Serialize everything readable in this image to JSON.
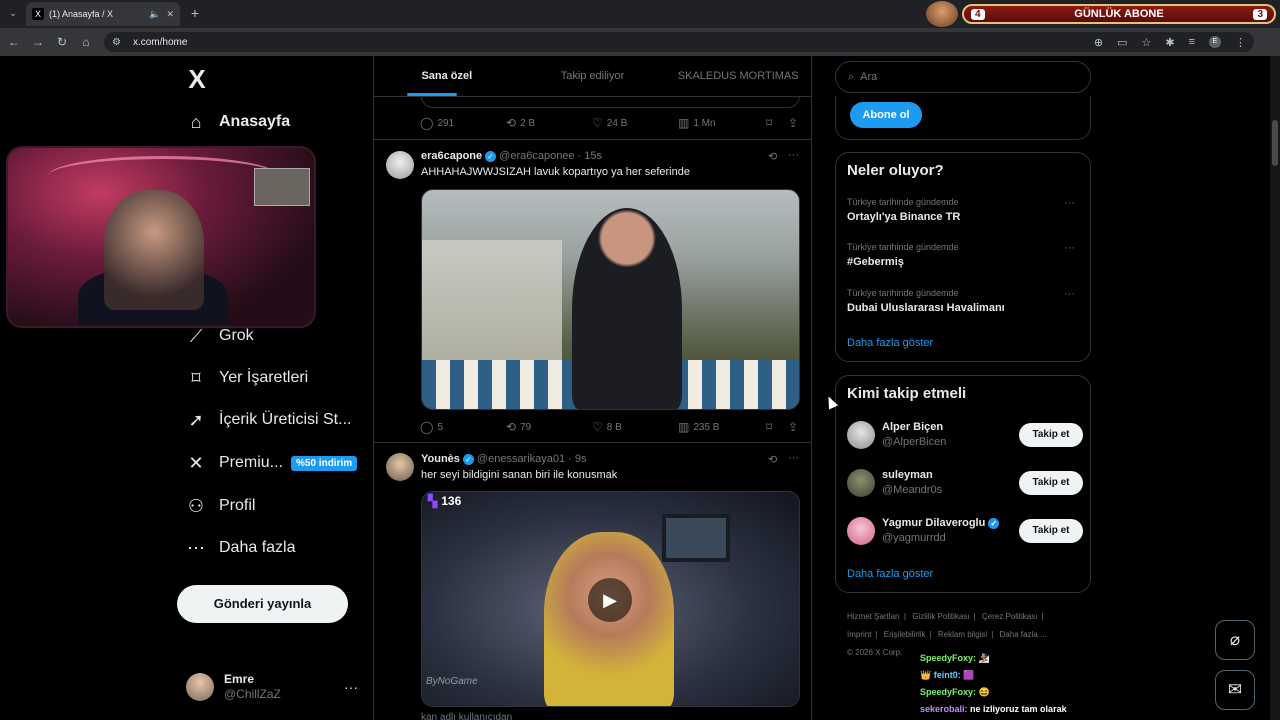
{
  "browser": {
    "tab_title": "(1) Anasayfa / X",
    "tab_favicon": "X",
    "url": "x.com/home",
    "profile_initial": "E"
  },
  "overlay": {
    "abone_left": "4",
    "abone_label": "GÜNLÜK ABONE",
    "abone_right": "3"
  },
  "nav": {
    "logo": "X",
    "items": [
      {
        "label": "Anasayfa",
        "icon": "home-icon"
      },
      {
        "label": "Grok",
        "icon": "grok-icon"
      },
      {
        "label": "Yer İşaretleri",
        "icon": "bookmark-icon"
      },
      {
        "label": "İçerik Üreticisi St...",
        "icon": "rocket-icon"
      },
      {
        "label": "Premiu...",
        "icon": "x-icon"
      },
      {
        "label": "Profil",
        "icon": "person-icon"
      },
      {
        "label": "Daha fazla",
        "icon": "more-circle-icon"
      }
    ],
    "premium_badge": "%50 indirim",
    "post_button": "Gönderi yayınla",
    "user": {
      "name": "Emre",
      "handle": "@ChillZaZ"
    }
  },
  "feed": {
    "tabs": [
      "Sana özel",
      "Takip ediliyor",
      "SKALEDUS MORTIMAS"
    ],
    "active_tab": 0,
    "prev_stats": {
      "replies": "291",
      "reposts": "2 B",
      "likes": "24 B",
      "views": "1 Mn"
    },
    "posts": [
      {
        "name": "era6capone",
        "handle": "@era6caponee",
        "time": "· 15s",
        "text": "AHHAHAJWWJSIZAH lavuk kopartıyo ya her seferinde",
        "replies": "5",
        "reposts": "79",
        "likes": "8 B",
        "views": "235 B"
      },
      {
        "name": "Younès",
        "handle": "@enessarikaya01",
        "time": "· 9s",
        "text": "her seyi bildigini sanan biri ile konusmak",
        "twitch_count": "136",
        "watermark": "ByNoGame"
      }
    ],
    "next_snippet": "kan  adlı kullanıcıdan"
  },
  "right": {
    "search_placeholder": "Ara",
    "subscribe_button": "Abone ol",
    "trends_title": "Neler oluyor?",
    "trends": [
      {
        "context": "Türkiye tarihinde gündemde",
        "name": "Ortaylı'ya Binance TR"
      },
      {
        "context": "Türkiye tarihinde gündemde",
        "name": "#Gebermiş"
      },
      {
        "context": "Türkiye tarihinde gündemde",
        "name": "Dubai Uluslararası Havalimanı"
      }
    ],
    "show_more": "Daha fazla göster",
    "who_title": "Kimi takip etmeli",
    "who": [
      {
        "name": "Alper Biçen",
        "handle": "@AlperBicen",
        "button": "Takip et",
        "verified": false
      },
      {
        "name": "suleyman",
        "handle": "@Meandr0s",
        "button": "Takip et",
        "verified": false
      },
      {
        "name": "Yagmur Dilaveroglu",
        "handle": "@yagmurrdd",
        "button": "Takip et",
        "verified": true
      }
    ],
    "footer_links": [
      "Hizmet Şartları",
      "Gizlilik Politikası",
      "Çerez Politikası",
      "Imprint",
      "Erişilebilirlik",
      "Reklam bilgisi",
      "Daha fazla ..."
    ],
    "copyright": "© 2026 X Corp."
  },
  "chat": [
    {
      "user": "SpeedyFoxy:",
      "msg": "🏂"
    },
    {
      "user": "👑 feint0:",
      "msg": "🟪"
    },
    {
      "user": "SpeedyFoxy:",
      "msg": "😆"
    },
    {
      "user": "sekerobali:",
      "msg": "ne izliyoruz tam olarak"
    }
  ],
  "colors": {
    "accent": "#1d9bf0",
    "bg": "#000000",
    "border": "#2f3336",
    "muted": "#71767b"
  }
}
